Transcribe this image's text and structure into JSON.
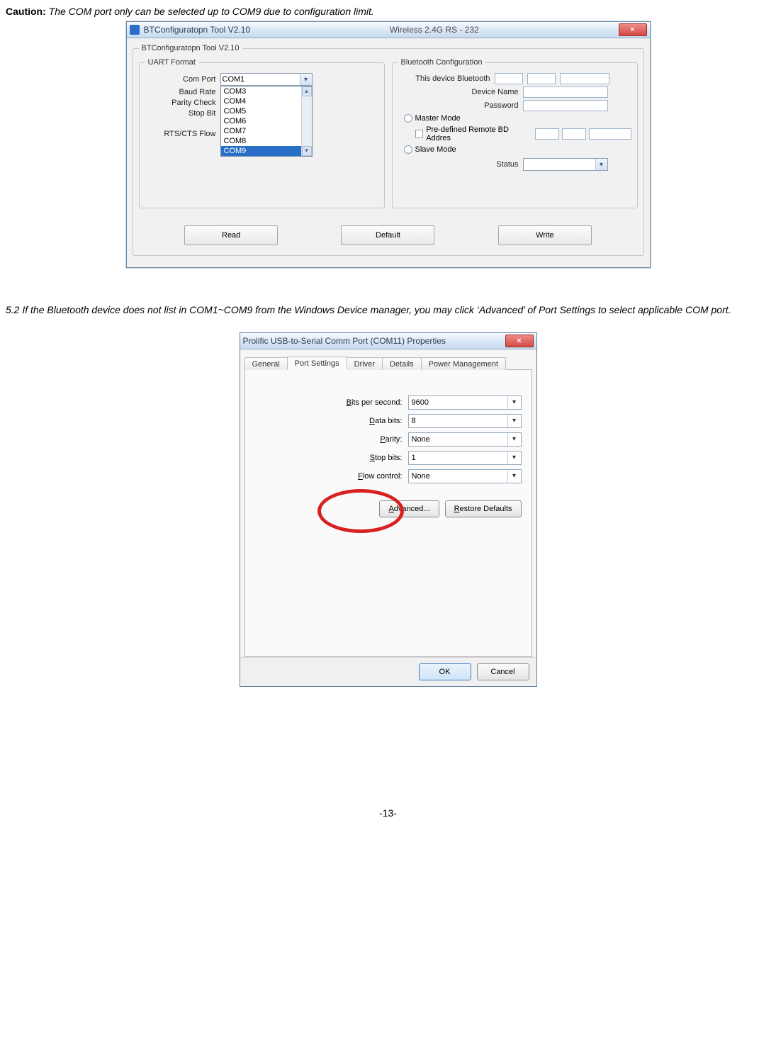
{
  "caution_label": "Caution:",
  "caution_text": "The COM port only can be selected up to COM9 due to configuration limit.",
  "win1": {
    "title_left": "BTConfiguratopn Tool V2.10",
    "title_center": "Wireless 2.4G RS - 232",
    "close_x": "×",
    "outer_group": "BTConfiguratopn Tool V2.10",
    "uart_group": "UART Format",
    "bt_group": "Bluetooth Configuration",
    "labels": {
      "com_port": "Com Port",
      "baud_rate": "Baud Rate",
      "parity": "Parity Check",
      "stop_bit": "Stop Bit",
      "rtscts": "RTS/CTS Flow",
      "this_device": "This device Bluetooth",
      "device_name": "Device Name",
      "password": "Password",
      "master": "Master Mode",
      "predefined": "Pre-defined Remote BD Addres",
      "slave": "Slave Mode",
      "status": "Status"
    },
    "com_value": "COM1",
    "com_options": [
      "COM3",
      "COM4",
      "COM5",
      "COM6",
      "COM7",
      "COM8",
      "COM9"
    ],
    "com_selected_option": "COM9",
    "buttons": {
      "read": "Read",
      "default": "Default",
      "write": "Write"
    }
  },
  "section_5_2": "5.2   If the Bluetooth device does not list in COM1~COM9 from the Windows Device manager, you may click ‘Advanced’ of Port Settings to select applicable COM port.",
  "win2": {
    "title": "Prolific USB-to-Serial Comm Port (COM11) Properties",
    "close_x": "×",
    "tabs": [
      "General",
      "Port Settings",
      "Driver",
      "Details",
      "Power Management"
    ],
    "active_tab": "Port Settings",
    "rows": {
      "bits_label_pre": "",
      "bits_label": "Bits per second:",
      "bits_u": "B",
      "bits_val": "9600",
      "data_label": "Data bits:",
      "data_u": "D",
      "data_val": "8",
      "parity_label": "Parity:",
      "parity_u": "P",
      "parity_val": "None",
      "stop_label": "Stop bits:",
      "stop_u": "S",
      "stop_val": "1",
      "flow_label": "Flow control:",
      "flow_u": "F",
      "flow_val": "None"
    },
    "advanced_btn": "Advanced...",
    "advanced_u": "A",
    "restore_btn": "Restore Defaults",
    "restore_u": "R",
    "ok": "OK",
    "cancel": "Cancel"
  },
  "page_number": "-13-"
}
